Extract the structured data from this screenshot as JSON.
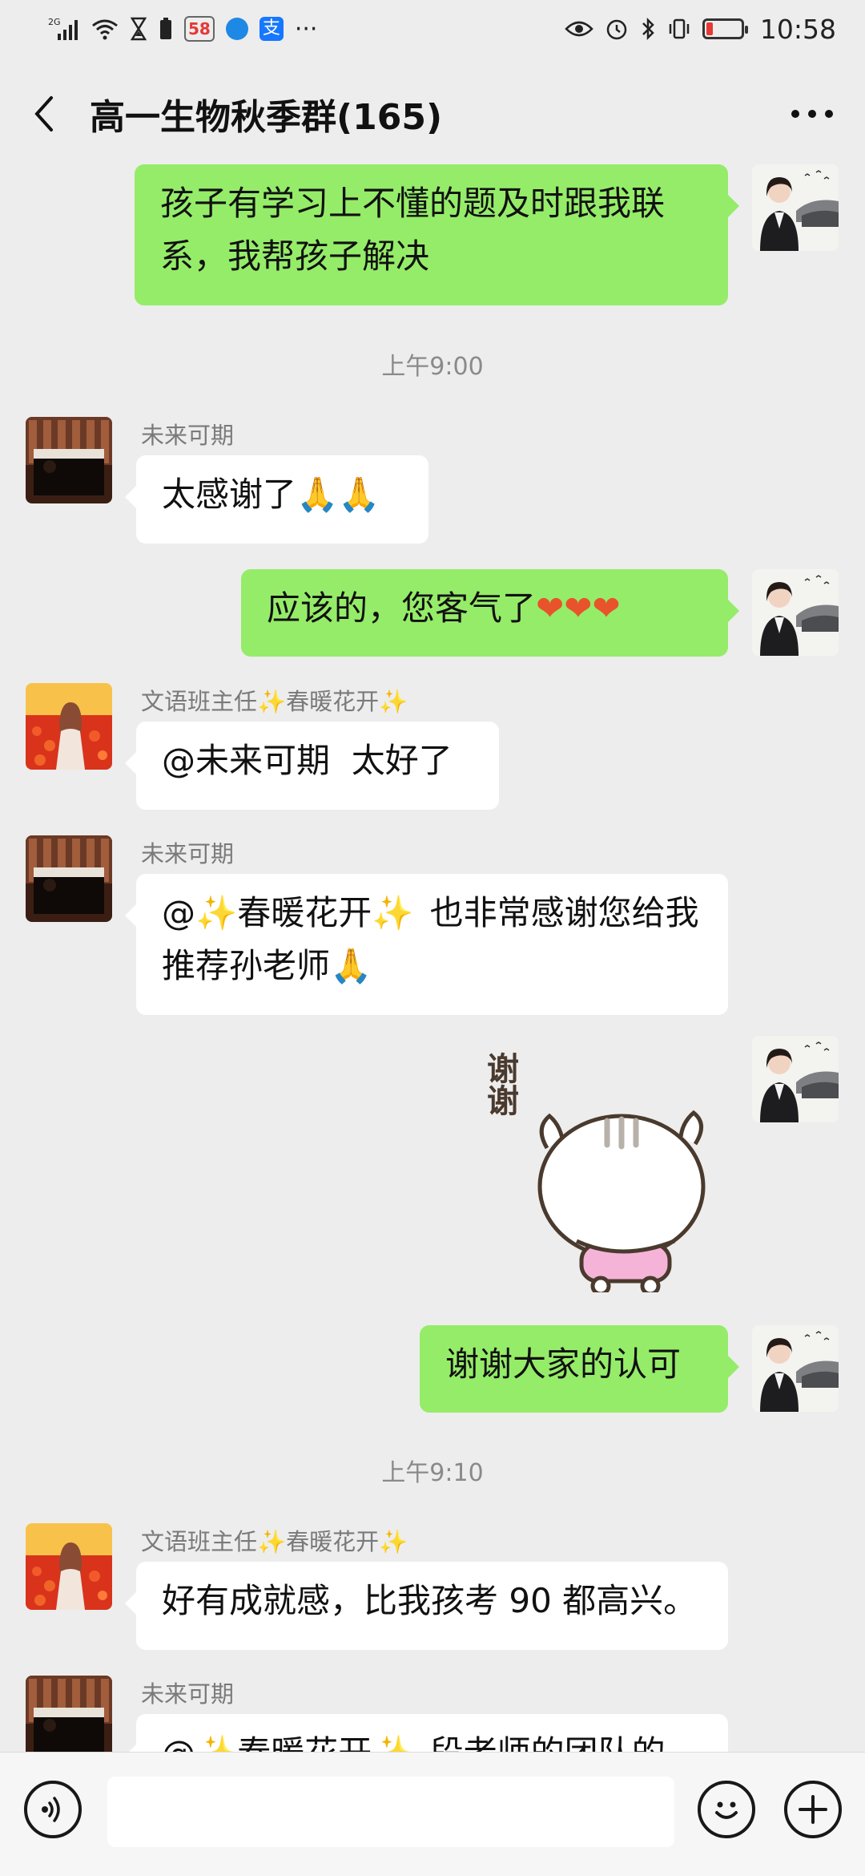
{
  "status_bar": {
    "network": "2G",
    "app_badge": "58",
    "alipay_char": "支",
    "more": "···",
    "time": "10:58"
  },
  "header": {
    "title": "高一生物秋季群(165)"
  },
  "messages": [
    {
      "text": "孩子有学习上不懂的题及时跟我联系，我帮孩子解决"
    },
    {
      "time": "上午9:00"
    },
    {
      "sender": "未来可期",
      "text": "太感谢了"
    },
    {
      "text": "应该的，您客气了"
    },
    {
      "sender_prefix": "文语班主任",
      "sender_name": "春暖花开",
      "text": "@未来可期  太好了"
    },
    {
      "sender": "未来可期",
      "mention": "春暖花开",
      "text": "也非常感谢您给我推荐孙老师"
    },
    {
      "sticker_text": "谢谢"
    },
    {
      "text": "谢谢大家的认可"
    },
    {
      "time": "上午9:10"
    },
    {
      "sender_prefix": "文语班主任",
      "sender_name": "春暖花开",
      "text": "好有成就感，比我孩考 90 都高兴。"
    },
    {
      "sender": "未来可期",
      "mention": "春暖花开",
      "text": "段老师的团队的"
    }
  ],
  "icons": {
    "back": "chevron-left-icon",
    "more": "more-dots-icon",
    "voice": "voice-icon",
    "emoji": "emoji-icon",
    "plus": "plus-icon",
    "bow": "bow-hands-emoji",
    "heart": "orange-heart-emoji",
    "sparkle": "sparkles-emoji"
  },
  "colors": {
    "outgoing_bubble": "#95ec69",
    "incoming_bubble": "#ffffff",
    "background": "#ededed"
  }
}
